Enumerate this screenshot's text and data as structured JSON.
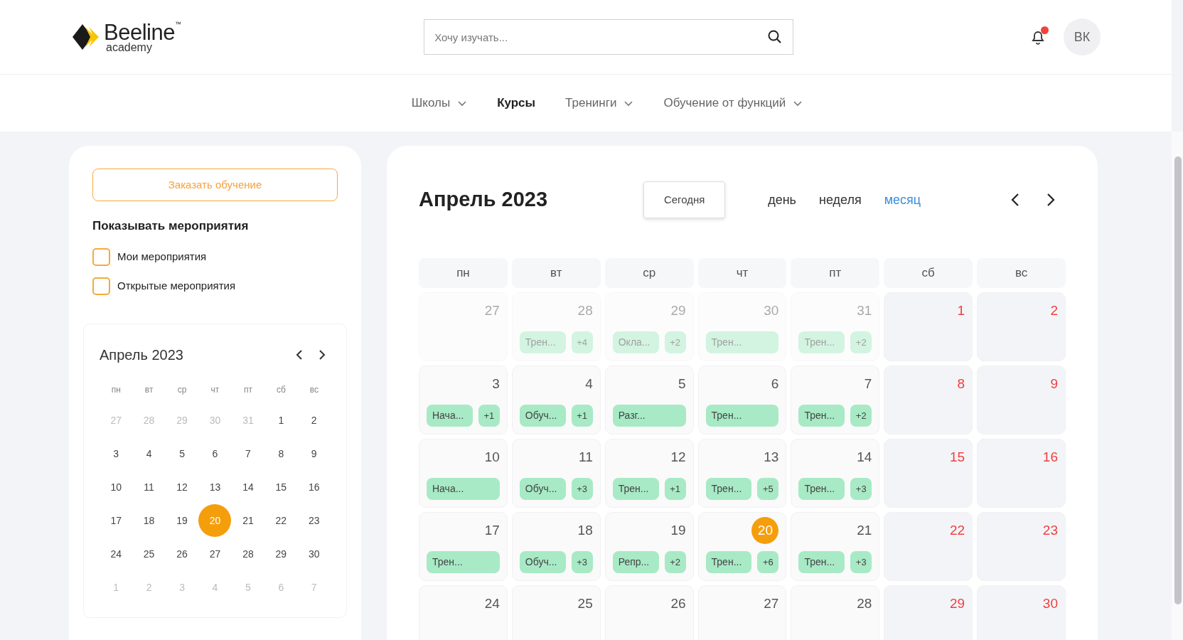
{
  "header": {
    "logo": {
      "name": "Beeline",
      "mark": "™",
      "sub": "academy"
    },
    "search": {
      "placeholder": "Хочу изучать..."
    },
    "notifications": {
      "unread": true
    },
    "avatar": "ВК"
  },
  "nav": [
    {
      "label": "Школы",
      "selected": false,
      "dropdown": true
    },
    {
      "label": "Курсы",
      "selected": true,
      "dropdown": false
    },
    {
      "label": "Тренинги",
      "selected": false,
      "dropdown": true
    },
    {
      "label": "Обучение от функций",
      "selected": false,
      "dropdown": true
    }
  ],
  "sidebar": {
    "order_button": "Заказать обучение",
    "filter_title": "Показывать мероприятия",
    "filters": [
      {
        "label": "Мои мероприятия",
        "checked": false
      },
      {
        "label": "Открытые мероприятия",
        "checked": false
      }
    ],
    "mini_calendar": {
      "title": "Апрель 2023",
      "weekdays": [
        "пн",
        "вт",
        "ср",
        "чт",
        "пт",
        "сб",
        "вс"
      ],
      "weeks": [
        [
          {
            "day": "27",
            "in_month": false,
            "selected": false
          },
          {
            "day": "28",
            "in_month": false,
            "selected": false
          },
          {
            "day": "29",
            "in_month": false,
            "selected": false
          },
          {
            "day": "30",
            "in_month": false,
            "selected": false
          },
          {
            "day": "31",
            "in_month": false,
            "selected": false
          },
          {
            "day": "1",
            "in_month": true,
            "selected": false
          },
          {
            "day": "2",
            "in_month": true,
            "selected": false
          }
        ],
        [
          {
            "day": "3",
            "in_month": true,
            "selected": false
          },
          {
            "day": "4",
            "in_month": true,
            "selected": false
          },
          {
            "day": "5",
            "in_month": true,
            "selected": false
          },
          {
            "day": "6",
            "in_month": true,
            "selected": false
          },
          {
            "day": "7",
            "in_month": true,
            "selected": false
          },
          {
            "day": "8",
            "in_month": true,
            "selected": false
          },
          {
            "day": "9",
            "in_month": true,
            "selected": false
          }
        ],
        [
          {
            "day": "10",
            "in_month": true,
            "selected": false
          },
          {
            "day": "11",
            "in_month": true,
            "selected": false
          },
          {
            "day": "12",
            "in_month": true,
            "selected": false
          },
          {
            "day": "13",
            "in_month": true,
            "selected": false
          },
          {
            "day": "14",
            "in_month": true,
            "selected": false
          },
          {
            "day": "15",
            "in_month": true,
            "selected": false
          },
          {
            "day": "16",
            "in_month": true,
            "selected": false
          }
        ],
        [
          {
            "day": "17",
            "in_month": true,
            "selected": false
          },
          {
            "day": "18",
            "in_month": true,
            "selected": false
          },
          {
            "day": "19",
            "in_month": true,
            "selected": false
          },
          {
            "day": "20",
            "in_month": true,
            "selected": true
          },
          {
            "day": "21",
            "in_month": true,
            "selected": false
          },
          {
            "day": "22",
            "in_month": true,
            "selected": false
          },
          {
            "day": "23",
            "in_month": true,
            "selected": false
          }
        ],
        [
          {
            "day": "24",
            "in_month": true,
            "selected": false
          },
          {
            "day": "25",
            "in_month": true,
            "selected": false
          },
          {
            "day": "26",
            "in_month": true,
            "selected": false
          },
          {
            "day": "27",
            "in_month": true,
            "selected": false
          },
          {
            "day": "28",
            "in_month": true,
            "selected": false
          },
          {
            "day": "29",
            "in_month": true,
            "selected": false
          },
          {
            "day": "30",
            "in_month": true,
            "selected": false
          }
        ],
        [
          {
            "day": "1",
            "in_month": false,
            "selected": false
          },
          {
            "day": "2",
            "in_month": false,
            "selected": false
          },
          {
            "day": "3",
            "in_month": false,
            "selected": false
          },
          {
            "day": "4",
            "in_month": false,
            "selected": false
          },
          {
            "day": "5",
            "in_month": false,
            "selected": false
          },
          {
            "day": "6",
            "in_month": false,
            "selected": false
          },
          {
            "day": "7",
            "in_month": false,
            "selected": false
          }
        ]
      ]
    }
  },
  "calendar": {
    "title": "Апрель 2023",
    "today_button": "Сегодня",
    "views": [
      {
        "label": "день",
        "selected": false
      },
      {
        "label": "неделя",
        "selected": false
      },
      {
        "label": "месяц",
        "selected": true
      }
    ],
    "weekdays": [
      "пн",
      "вт",
      "ср",
      "чт",
      "пт",
      "сб",
      "вс"
    ],
    "weeks": [
      [
        {
          "day": "27",
          "in_month": false,
          "weekend": false,
          "today": false
        },
        {
          "day": "28",
          "in_month": false,
          "weekend": false,
          "today": false,
          "events": [
            "Трен..."
          ],
          "more": "+4"
        },
        {
          "day": "29",
          "in_month": false,
          "weekend": false,
          "today": false,
          "events": [
            "Окла..."
          ],
          "more": "+2"
        },
        {
          "day": "30",
          "in_month": false,
          "weekend": false,
          "today": false,
          "events": [
            "Трен..."
          ]
        },
        {
          "day": "31",
          "in_month": false,
          "weekend": false,
          "today": false,
          "events": [
            "Трен..."
          ],
          "more": "+2"
        },
        {
          "day": "1",
          "in_month": true,
          "weekend": true,
          "today": false
        },
        {
          "day": "2",
          "in_month": true,
          "weekend": true,
          "today": false
        }
      ],
      [
        {
          "day": "3",
          "in_month": true,
          "weekend": false,
          "today": false,
          "events": [
            "Нача..."
          ],
          "more": "+1"
        },
        {
          "day": "4",
          "in_month": true,
          "weekend": false,
          "today": false,
          "events": [
            "Обуч..."
          ],
          "more": "+1"
        },
        {
          "day": "5",
          "in_month": true,
          "weekend": false,
          "today": false,
          "events": [
            "Разг..."
          ]
        },
        {
          "day": "6",
          "in_month": true,
          "weekend": false,
          "today": false,
          "events": [
            "Трен..."
          ]
        },
        {
          "day": "7",
          "in_month": true,
          "weekend": false,
          "today": false,
          "events": [
            "Трен..."
          ],
          "more": "+2"
        },
        {
          "day": "8",
          "in_month": true,
          "weekend": true,
          "today": false
        },
        {
          "day": "9",
          "in_month": true,
          "weekend": true,
          "today": false
        }
      ],
      [
        {
          "day": "10",
          "in_month": true,
          "weekend": false,
          "today": false,
          "events": [
            "Нача..."
          ]
        },
        {
          "day": "11",
          "in_month": true,
          "weekend": false,
          "today": false,
          "events": [
            "Обуч..."
          ],
          "more": "+3"
        },
        {
          "day": "12",
          "in_month": true,
          "weekend": false,
          "today": false,
          "events": [
            "Трен..."
          ],
          "more": "+1"
        },
        {
          "day": "13",
          "in_month": true,
          "weekend": false,
          "today": false,
          "events": [
            "Трен..."
          ],
          "more": "+5"
        },
        {
          "day": "14",
          "in_month": true,
          "weekend": false,
          "today": false,
          "events": [
            "Трен..."
          ],
          "more": "+3"
        },
        {
          "day": "15",
          "in_month": true,
          "weekend": true,
          "today": false
        },
        {
          "day": "16",
          "in_month": true,
          "weekend": true,
          "today": false
        }
      ],
      [
        {
          "day": "17",
          "in_month": true,
          "weekend": false,
          "today": false,
          "events": [
            "Трен..."
          ]
        },
        {
          "day": "18",
          "in_month": true,
          "weekend": false,
          "today": false,
          "events": [
            "Обуч..."
          ],
          "more": "+3"
        },
        {
          "day": "19",
          "in_month": true,
          "weekend": false,
          "today": false,
          "events": [
            "Репр..."
          ],
          "more": "+2"
        },
        {
          "day": "20",
          "in_month": true,
          "weekend": false,
          "today": true,
          "events": [
            "Трен..."
          ],
          "more": "+6"
        },
        {
          "day": "21",
          "in_month": true,
          "weekend": false,
          "today": false,
          "events": [
            "Трен..."
          ],
          "more": "+3"
        },
        {
          "day": "22",
          "in_month": true,
          "weekend": true,
          "today": false
        },
        {
          "day": "23",
          "in_month": true,
          "weekend": true,
          "today": false
        }
      ],
      [
        {
          "day": "24",
          "in_month": true,
          "weekend": false,
          "today": false
        },
        {
          "day": "25",
          "in_month": true,
          "weekend": false,
          "today": false
        },
        {
          "day": "26",
          "in_month": true,
          "weekend": false,
          "today": false
        },
        {
          "day": "27",
          "in_month": true,
          "weekend": false,
          "today": false
        },
        {
          "day": "28",
          "in_month": true,
          "weekend": false,
          "today": false
        },
        {
          "day": "29",
          "in_month": true,
          "weekend": true,
          "today": false
        },
        {
          "day": "30",
          "in_month": true,
          "weekend": true,
          "today": false
        }
      ]
    ]
  }
}
